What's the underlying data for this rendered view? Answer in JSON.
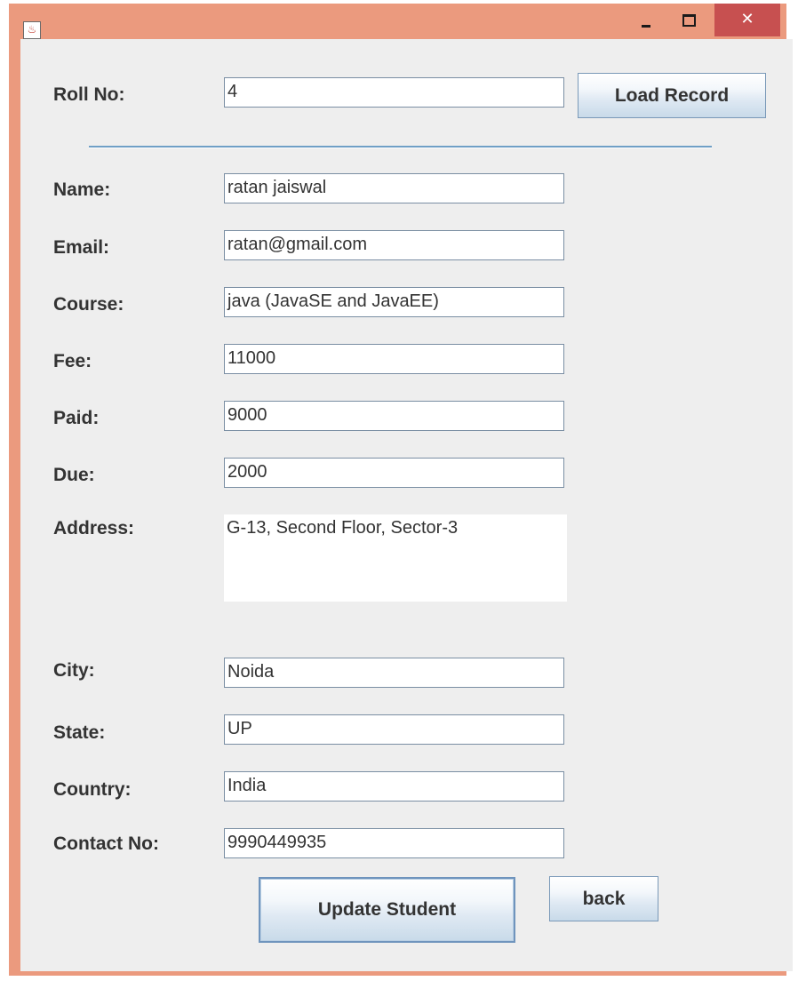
{
  "window": {
    "icon": "java-app-icon",
    "controls": {
      "minimize": "minimize-icon",
      "maximize": "maximize-icon",
      "close_label": "✕"
    }
  },
  "roll": {
    "label": "Roll No:",
    "value": "4",
    "load_button": "Load Record"
  },
  "fields": {
    "name": {
      "label": "Name:",
      "value": "ratan jaiswal"
    },
    "email": {
      "label": "Email:",
      "value": "ratan@gmail.com"
    },
    "course": {
      "label": "Course:",
      "value": "java (JavaSE and JavaEE)"
    },
    "fee": {
      "label": "Fee:",
      "value": "11000"
    },
    "paid": {
      "label": "Paid:",
      "value": "9000"
    },
    "due": {
      "label": "Due:",
      "value": "2000"
    },
    "address": {
      "label": "Address:",
      "value": "G-13, Second Floor, Sector-3"
    },
    "city": {
      "label": "City:",
      "value": "Noida"
    },
    "state": {
      "label": "State:",
      "value": "UP"
    },
    "country": {
      "label": "Country:",
      "value": "India"
    },
    "contact": {
      "label": "Contact No:",
      "value": "9990449935"
    }
  },
  "actions": {
    "update_button": "Update Student",
    "back_button": "back"
  },
  "colors": {
    "title_bar": "#eb9a7e",
    "close_button": "#c75050",
    "panel_background": "#eeeeee",
    "separator": "#6f9fc6"
  }
}
